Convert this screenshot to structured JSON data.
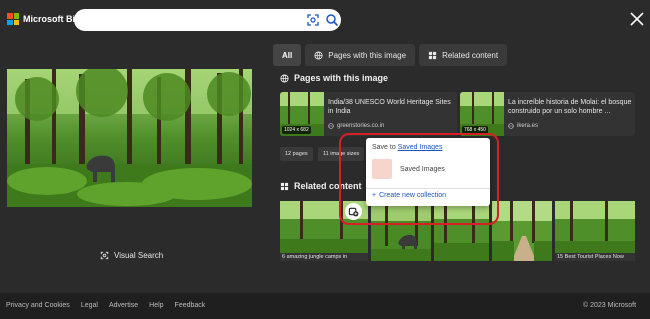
{
  "header": {
    "logo_text": "Microsoft Bing",
    "search_value": "",
    "search_placeholder": ""
  },
  "left": {
    "visual_search_label": "Visual Search"
  },
  "tabs": [
    {
      "label": "All",
      "icon": "none"
    },
    {
      "label": "Pages with this image",
      "icon": "globe-icon"
    },
    {
      "label": "Related content",
      "icon": "grid-icon"
    }
  ],
  "pages_section": {
    "title": "Pages with this image",
    "cards": [
      {
        "title": "India/38 UNESCO World Heritage Sites in India",
        "domain": "greenstories.co.in",
        "size": "1024 x 682"
      },
      {
        "title": "La increíble historia de Molai: el bosque construido por un solo hombre ...",
        "domain": "ikera.es",
        "size": "768 x 450"
      }
    ],
    "chips": [
      "12 pages",
      "11 image sizes"
    ]
  },
  "related_section": {
    "title": "Related content",
    "items": [
      {
        "caption": "6 amazing jungle camps in"
      },
      {
        "caption": ""
      },
      {
        "caption": ""
      },
      {
        "caption": ""
      },
      {
        "caption": "15 Best Tourist Places Now"
      }
    ]
  },
  "popup": {
    "save_to_prefix": "Save to",
    "save_to_link": "Saved Images",
    "collection_label": "Saved Images",
    "new_collection": "Create new collection"
  },
  "footer": {
    "links": [
      "Privacy and Cookies",
      "Legal",
      "Advertise",
      "Help",
      "Feedback"
    ],
    "copyright": "© 2023 Microsoft"
  },
  "colors": {
    "background": "#2b2b2b",
    "accent_blue": "#1a56c2",
    "highlight_red": "#d61f26",
    "footer_bg": "#1f1f1f"
  }
}
